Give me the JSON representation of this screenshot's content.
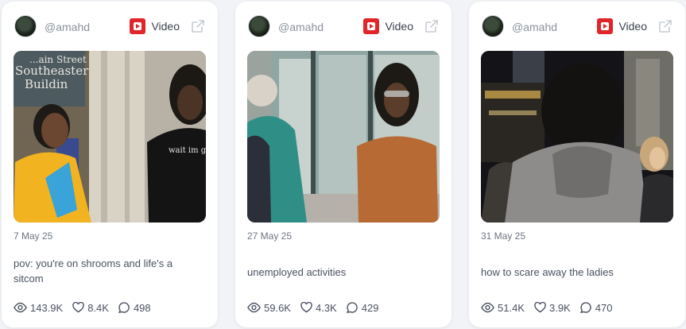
{
  "posts": [
    {
      "handle": "@amahd",
      "source": "Video",
      "date": "7 May 25",
      "caption": "pov: you're on shrooms and life's a sitcom",
      "views": "143.9K",
      "likes": "8.4K",
      "comments": "498",
      "thumb_text": [
        "...ain Street",
        "Southeaster",
        "Buildin",
        "wait im go"
      ]
    },
    {
      "handle": "@amahd",
      "source": "Video",
      "date": "27 May 25",
      "caption": "unemployed activities",
      "views": "59.6K",
      "likes": "4.3K",
      "comments": "429"
    },
    {
      "handle": "@amahd",
      "source": "Video",
      "date": "31 May 25",
      "caption": "how to scare away the ladies",
      "views": "51.4K",
      "likes": "3.9K",
      "comments": "470"
    }
  ],
  "icons": {
    "source": "youtube-icon",
    "external": "external-link-icon",
    "views": "eye-icon",
    "likes": "heart-icon",
    "comments": "comment-icon"
  },
  "colors": {
    "youtube_red": "#e0262a",
    "card_bg": "#ffffff",
    "page_bg": "#f1f3f6"
  }
}
